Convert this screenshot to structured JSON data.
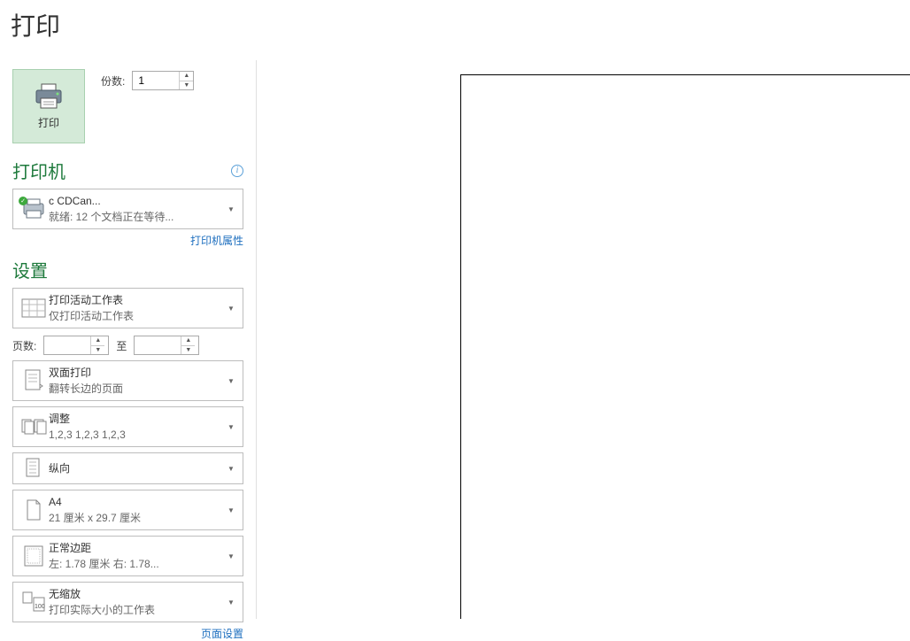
{
  "title": "打印",
  "print": {
    "button_label": "打印"
  },
  "copies": {
    "label": "份数:",
    "value": "1"
  },
  "printer": {
    "header": "打印机",
    "name": "c                  CDCan...",
    "status": "就绪: 12 个文档正在等待...",
    "properties_link": "打印机属性"
  },
  "settings": {
    "header": "设置",
    "scope": {
      "title": "打印活动工作表",
      "sub": "仅打印活动工作表"
    },
    "pages_label": "页数:",
    "pages_to": "至",
    "pages_from": "",
    "pages_to_val": "",
    "sides": {
      "title": "双面打印",
      "sub": "翻转长边的页面"
    },
    "collate": {
      "title": "调整",
      "sub": "1,2,3     1,2,3     1,2,3"
    },
    "orientation": {
      "title": "纵向"
    },
    "paper": {
      "title": "A4",
      "sub": "21 厘米 x 29.7 厘米"
    },
    "margins": {
      "title": "正常边距",
      "sub": "左:  1.78 厘米    右:  1.78..."
    },
    "scaling": {
      "title": "无缩放",
      "sub": "打印实际大小的工作表"
    },
    "page_setup_link": "页面设置"
  }
}
